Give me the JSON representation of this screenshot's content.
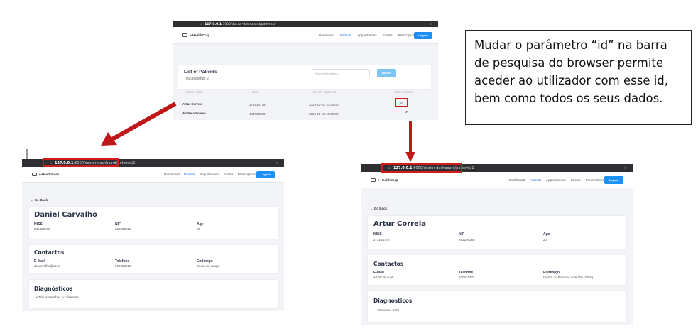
{
  "annotation": {
    "text": "Mudar o parâmetro “id” na barra de pesquisa do browser permite aceder ao utilizador com esse id, bem como todos os seus dados."
  },
  "colors": {
    "arrow": "#c01818",
    "highlight": "#d01c1c",
    "accent": "#1e8ff5"
  },
  "browser": {
    "url_host": "127.0.0.1",
    "url_path": ":5000/doctor-dashboard/patients/",
    "url_path_detail": ":5000/doctor-dashboard/patients/1"
  },
  "nav": {
    "brand": "e-HealthCorp",
    "links": [
      "Dashboard",
      "Patients",
      "Appointments",
      "Exams",
      "Prescriptions"
    ],
    "active": "Patients",
    "logout": "Logout"
  },
  "patients_list": {
    "title": "List of Patients",
    "total": "Total patients: 2",
    "search_placeholder": "Search for patient",
    "search_button": "Search",
    "columns": [
      "Patient Name",
      "NISS",
      "Last Appointment",
      "More Details"
    ],
    "rows": [
      {
        "name": "Artur Correia",
        "niss": "273134778",
        "last": "2022-11-10 10:00:00"
      },
      {
        "name": "Andreia Soares",
        "niss": "444883050",
        "last": "2022-11-10 10:00:00"
      }
    ]
  },
  "detail_left": {
    "back": "Go Back",
    "name": "Daniel Carvalho",
    "niss_label": "NISS",
    "niss": "245499593",
    "nif_label": "NIF",
    "nif": "222222222",
    "age_label": "Age",
    "age": "25",
    "contacts_title": "Contactos",
    "email_label": "E-Mail",
    "email": "dt.carvalho@ua.pt",
    "phone_label": "Telefone",
    "phone": "962368016",
    "address_label": "Endereço",
    "address": "Sever do Vouga",
    "diag_title": "Diagnósticos",
    "diag_item": "This patient has no diseases"
  },
  "detail_right": {
    "back": "Go Back",
    "name": "Artur Correia",
    "niss_label": "NISS",
    "niss": "273134778",
    "nif_label": "NIF",
    "nif": "262195185",
    "age_label": "Age",
    "age": "20",
    "contacts_title": "Contactos",
    "email_label": "E-Mail",
    "email": "art.afc@ua.pt",
    "phone_label": "Telefone",
    "phone": "930571403",
    "address_label": "Endereço",
    "address": "Quinta do Bosque, Lote 110, 2ºEsq",
    "diag_title": "Diagnósticos",
    "diag_item": "Common Cold"
  }
}
